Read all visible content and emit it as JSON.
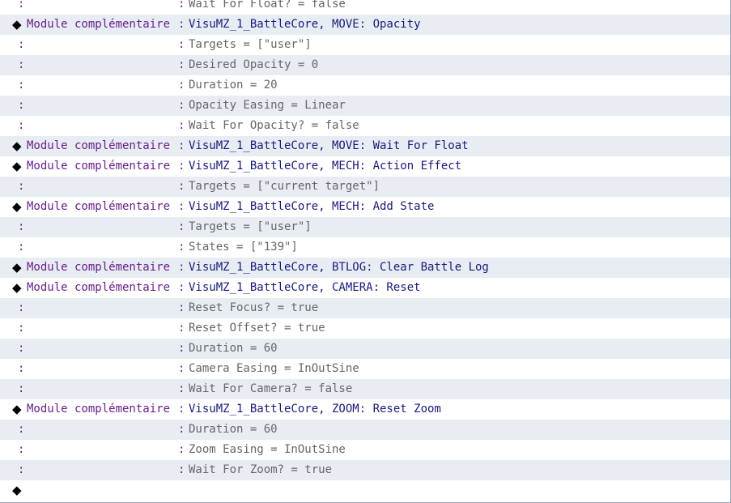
{
  "symbols": {
    "marker": "◆",
    "separator": ":"
  },
  "rows": [
    {
      "kind": "param",
      "left": ":",
      "text": "Wait For Float? = false"
    },
    {
      "kind": "command",
      "left": "Module complémentaire",
      "text": "VisuMZ_1_BattleCore, MOVE: Opacity"
    },
    {
      "kind": "param",
      "left": ":",
      "text": "Targets = [\"user\"]"
    },
    {
      "kind": "param",
      "left": ":",
      "text": "Desired Opacity = 0"
    },
    {
      "kind": "param",
      "left": ":",
      "text": "Duration = 20"
    },
    {
      "kind": "param",
      "left": ":",
      "text": "Opacity Easing = Linear"
    },
    {
      "kind": "param",
      "left": ":",
      "text": "Wait For Opacity? = false"
    },
    {
      "kind": "command",
      "left": "Module complémentaire",
      "text": "VisuMZ_1_BattleCore, MOVE: Wait For Float"
    },
    {
      "kind": "command",
      "left": "Module complémentaire",
      "text": "VisuMZ_1_BattleCore, MECH: Action Effect"
    },
    {
      "kind": "param",
      "left": ":",
      "text": "Targets = [\"current target\"]"
    },
    {
      "kind": "command",
      "left": "Module complémentaire",
      "text": "VisuMZ_1_BattleCore, MECH: Add State"
    },
    {
      "kind": "param",
      "left": ":",
      "text": "Targets = [\"user\"]"
    },
    {
      "kind": "param",
      "left": ":",
      "text": "States = [\"139\"]"
    },
    {
      "kind": "command",
      "left": "Module complémentaire",
      "text": "VisuMZ_1_BattleCore, BTLOG: Clear Battle Log"
    },
    {
      "kind": "command",
      "left": "Module complémentaire",
      "text": "VisuMZ_1_BattleCore, CAMERA: Reset"
    },
    {
      "kind": "param",
      "left": ":",
      "text": "Reset Focus? = true"
    },
    {
      "kind": "param",
      "left": ":",
      "text": "Reset Offset? = true"
    },
    {
      "kind": "param",
      "left": ":",
      "text": "Duration = 60"
    },
    {
      "kind": "param",
      "left": ":",
      "text": "Camera Easing = InOutSine"
    },
    {
      "kind": "param",
      "left": ":",
      "text": "Wait For Camera? = false"
    },
    {
      "kind": "command",
      "left": "Module complémentaire",
      "text": "VisuMZ_1_BattleCore, ZOOM: Reset Zoom"
    },
    {
      "kind": "param",
      "left": ":",
      "text": "Duration = 60"
    },
    {
      "kind": "param",
      "left": ":",
      "text": "Zoom Easing = InOutSine"
    },
    {
      "kind": "param",
      "left": ":",
      "text": "Wait For Zoom? = true"
    },
    {
      "kind": "end",
      "left": "",
      "text": ""
    }
  ]
}
